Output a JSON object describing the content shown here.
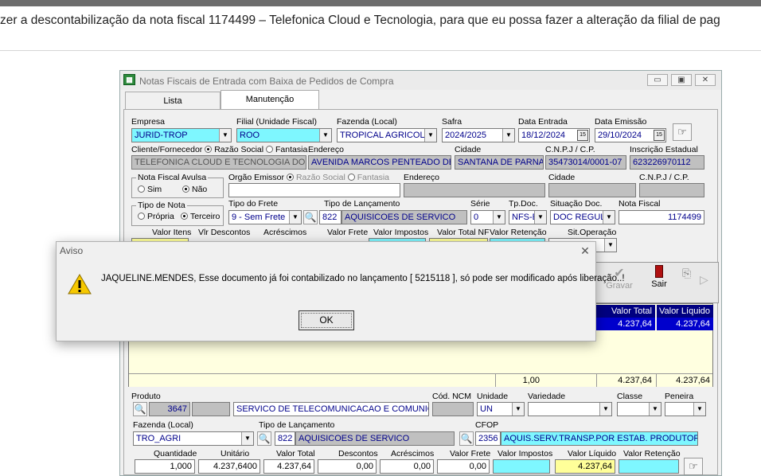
{
  "top_message": "zer a descontabilização da nota fiscal 1174499 – Telefonica Cloud e Tecnologia, para que eu possa fazer a alteração da filial de pag",
  "window": {
    "title": "Notas Fiscais de Entrada com Baixa de Pedidos de Compra",
    "tabs": [
      "Lista",
      "Manutenção"
    ],
    "controls": {
      "min": "▭",
      "max": "▣",
      "close": "✕"
    }
  },
  "form": {
    "empresa_label": "Empresa",
    "empresa_value": "JURID-TROP",
    "filial_label": "Filial (Unidade Fiscal)",
    "filial_value": "ROO",
    "fazenda_label": "Fazenda (Local)",
    "fazenda_value": "TROPICAL AGRICOLA",
    "safra_label": "Safra",
    "safra_value": "2024/2025",
    "data_entrada_label": "Data Entrada",
    "data_entrada_value": "18/12/2024",
    "data_emissao_label": "Data Emissão",
    "data_emissao_value": "29/10/2024",
    "cal_icon": "15",
    "cliente_label": "Cliente/Fornecedor",
    "razao_social_label": "Razão Social",
    "fantasia_label": "Fantasia",
    "cliente_value": "TELEFONICA CLOUD E TECNOLOGIA DO BRA",
    "endereco_label": "Endereço",
    "endereco_value": "AVENIDA MARCOS PENTEADO DE U",
    "cidade_label": "Cidade",
    "cidade_value": "SANTANA DE PARNAIE",
    "cnpj_label": "C.N.P.J / C.P.",
    "cnpj_value": "35473014/0001-07",
    "ie_label": "Inscrição Estadual",
    "ie_value": "623226970112",
    "avulsa_label": "Nota Fiscal Avulsa",
    "sim_label": "Sim",
    "nao_label": "Não",
    "orgao_label": "Orgão Emissor",
    "orgao_razao": "Razão Social",
    "orgao_fantasia": "Fantasia",
    "orgao_endereco_label": "Endereço",
    "orgao_cidade_label": "Cidade",
    "orgao_cnpj_label": "C.N.P.J / C.P.",
    "tipo_nota_label": "Tipo de Nota",
    "propria_label": "Própria",
    "terceiro_label": "Terceiro",
    "tipo_frete_label": "Tipo do Frete",
    "tipo_frete_value": "9 - Sem Frete",
    "tipo_lanc_label": "Tipo de Lançamento",
    "tipo_lanc_code": "822",
    "tipo_lanc_value": "AQUISICOES DE SERVICO",
    "serie_label": "Série",
    "serie_value": "0",
    "tpdoc_label": "Tp.Doc.",
    "tpdoc_value": "NFS-E",
    "situacao_label": "Situação Doc.",
    "situacao_value": "DOC REGUL",
    "nota_label": "Nota Fiscal",
    "nota_value": "1174499",
    "totals_labels": [
      "Valor Itens",
      "Vlr Descontos",
      "Acréscimos",
      "Valor Frete",
      "Valor Impostos",
      "Valor Total NF",
      "Valor Retenção",
      "Sit.Operação"
    ]
  },
  "toolbar": {
    "gravar_label": "Gravar",
    "sair_label": "Sair"
  },
  "grid": {
    "headers": [
      "Valor Total",
      "Valor Líquido"
    ],
    "row": [
      "4.237,64",
      "4.237,64"
    ],
    "footer": [
      "1,00",
      "4.237,64",
      "4.237,64"
    ]
  },
  "item": {
    "produto_label": "Produto",
    "produto_code": "3647",
    "produto_value": "SERVICO DE TELECOMUNICACAO E COMUNICAC",
    "cod_ncm_label": "Cód. NCM",
    "unidade_label": "Unidade",
    "unidade_value": "UN",
    "variedade_label": "Variedade",
    "classe_label": "Classe",
    "peneira_label": "Peneira",
    "fazenda_label": "Fazenda (Local)",
    "fazenda_value": "TRO_AGRI",
    "tipo_lanc_label": "Tipo de Lançamento",
    "tipo_lanc_code": "822",
    "tipo_lanc_value": "AQUISICOES DE SERVICO",
    "cfop_label": "CFOP",
    "cfop_code": "2356",
    "cfop_value": "AQUIS.SERV.TRANSP.POR ESTAB. PRODUTOR RU",
    "labels": [
      "Quantidade",
      "Unitário",
      "Valor Total",
      "Descontos",
      "Acréscimos",
      "Valor Frete",
      "Valor Impostos",
      "Valor Líquido",
      "Valor Retenção"
    ],
    "values": [
      "1,000",
      "4.237,6400",
      "4.237,64",
      "0,00",
      "0,00",
      "0,00",
      "",
      "4.237,64",
      ""
    ]
  },
  "dialog": {
    "title": "Aviso",
    "message": "JAQUELINE.MENDES, Esse documento já foi contabilizado no lançamento [ 5215118 ], só pode ser modificado após liberação..!",
    "ok_label": "OK",
    "close_label": "✕"
  }
}
